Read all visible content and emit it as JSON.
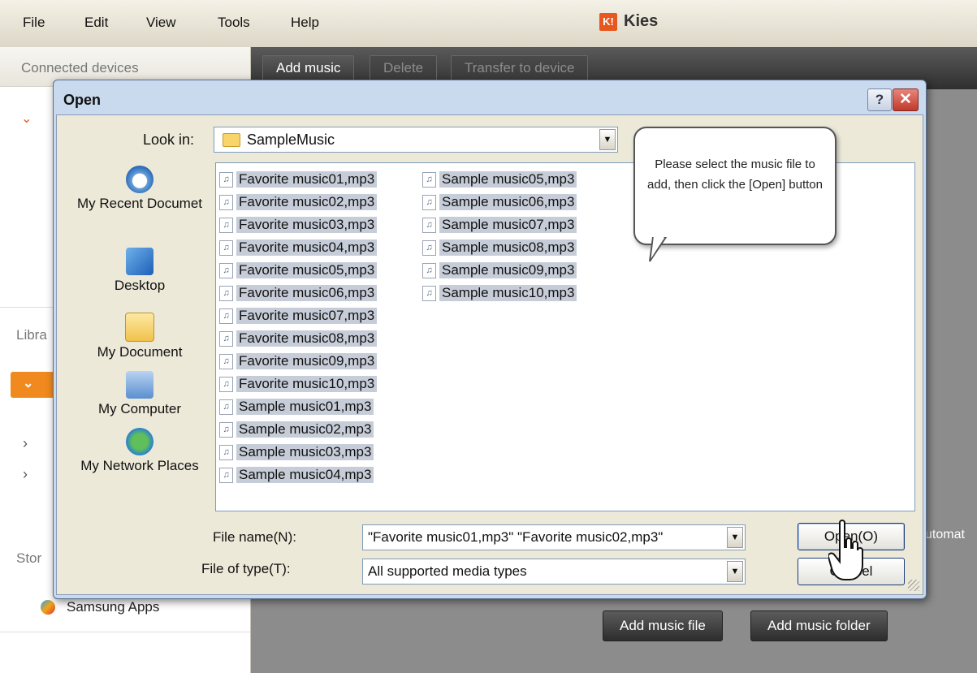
{
  "menubar": {
    "items": [
      "File",
      "Edit",
      "View",
      "Tools",
      "Help"
    ],
    "app_title": "Kies",
    "logo_text": "K!"
  },
  "sidebar": {
    "connected_devices": "Connected devices",
    "library_label": "Libra",
    "storage_label": "Stor",
    "samsung_apps": "Samsung Apps"
  },
  "main": {
    "toolbar": {
      "add_music": "Add music",
      "delete": "Delete",
      "transfer": "Transfer to device"
    },
    "add_music_file": "Add music file",
    "add_music_folder": "Add music folder",
    "automat_text": "utomat"
  },
  "dialog": {
    "title": "Open",
    "help_label": "?",
    "close_label": "✕",
    "look_in_label": "Look in:",
    "look_in_value": "SampleMusic",
    "places": [
      {
        "label": "My Recent Documet"
      },
      {
        "label": "Desktop"
      },
      {
        "label": "My Document"
      },
      {
        "label": "My Computer"
      },
      {
        "label": "My Network Places"
      }
    ],
    "files_col1": [
      "Favorite music01,mp3",
      "Favorite music02,mp3",
      "Favorite music03,mp3",
      "Favorite music04,mp3",
      "Favorite music05,mp3",
      "Favorite music06,mp3",
      "Favorite music07,mp3",
      "Favorite music08,mp3",
      "Favorite music09,mp3",
      "Favorite music10,mp3",
      "Sample music01,mp3",
      "Sample music02,mp3",
      "Sample music03,mp3",
      "Sample music04,mp3"
    ],
    "files_col2": [
      "Sample music05,mp3",
      "Sample music06,mp3",
      "Sample music07,mp3",
      "Sample music08,mp3",
      "Sample music09,mp3",
      "Sample music10,mp3"
    ],
    "file_name_label": "File name(N):",
    "file_name_value": "\"Favorite music01,mp3\" \"Favorite music02,mp3\"",
    "file_type_label": "File of type(T):",
    "file_type_value": "All supported media types",
    "open_button": "Open(O)",
    "cancel_button": "Cancel"
  },
  "callout": {
    "text": "Please select the music file to add, then click the [Open] button"
  }
}
